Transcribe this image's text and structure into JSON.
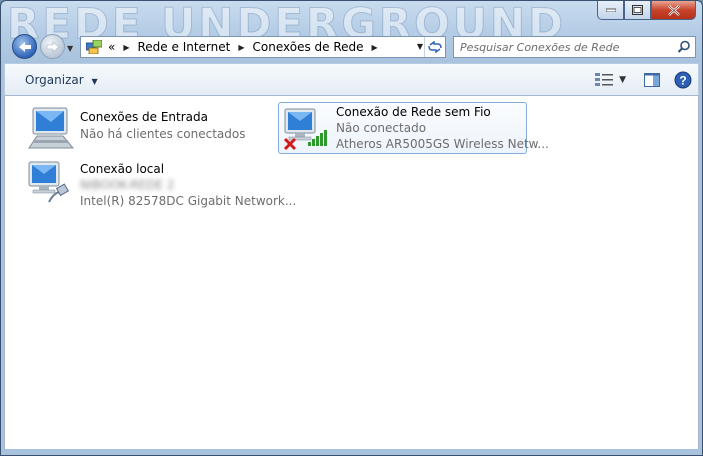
{
  "window": {
    "background_text": "REDE UNDERGROUND"
  },
  "address": {
    "recent_chevron": "«",
    "crumbs": [
      "Rede e Internet",
      "Conexões de Rede"
    ]
  },
  "search": {
    "placeholder": "Pesquisar Conexões de Rede"
  },
  "toolbar": {
    "organize_label": "Organizar"
  },
  "connections": [
    {
      "name": "Conexões de Entrada",
      "line2": "Não há clientes conectados",
      "line3": ""
    },
    {
      "name": "Conexão de Rede sem Fio",
      "line2": "Não conectado",
      "line3": "Atheros AR5005GS Wireless Netw...",
      "status": "disconnected"
    },
    {
      "name": "Conexão local",
      "line2": "NIBOOK-REDE 2",
      "line3": "Intel(R) 82578DC Gigabit Network..."
    }
  ],
  "colors": {
    "title_gradient_top": "#c9dcef",
    "accent_blue": "#2f63b7",
    "close_red": "#c7432b",
    "selection_border": "#84acdd"
  },
  "icons": [
    "back-arrow-icon",
    "forward-arrow-icon",
    "network-folder-icon",
    "refresh-icon",
    "search-icon",
    "view-options-icon",
    "preview-pane-icon",
    "help-icon",
    "network-computer-icon",
    "wireless-signal-icon",
    "red-x-icon",
    "ethernet-cable-icon"
  ]
}
